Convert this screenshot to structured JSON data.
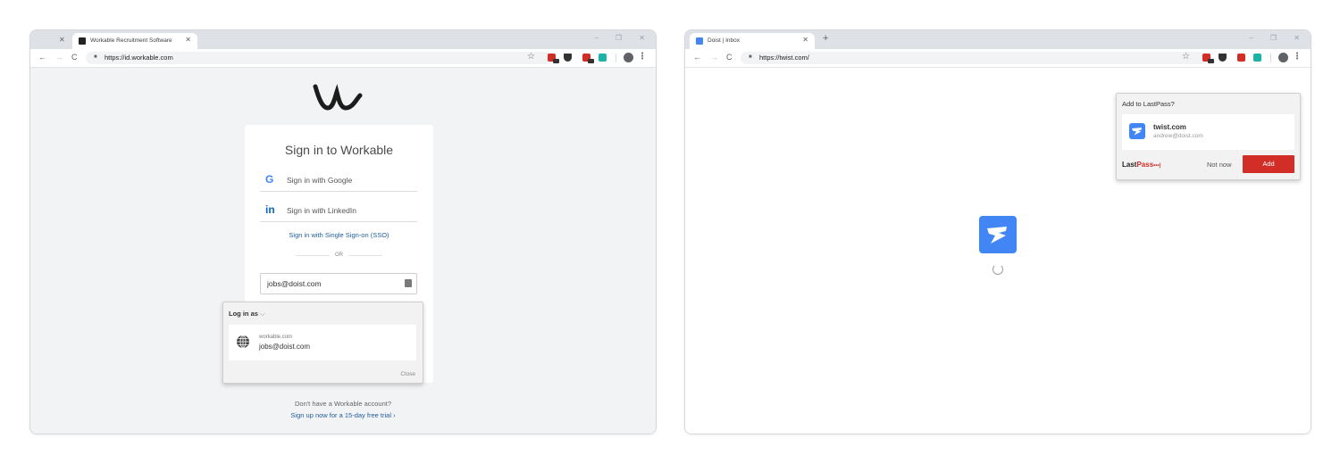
{
  "left_window": {
    "tab": {
      "title": "Workable Recruitment Software",
      "favicon_icon": "workable-favicon-icon"
    },
    "url": "https://id.workable.com",
    "window_controls": [
      "–",
      "❐",
      "✕"
    ],
    "signin": {
      "title": "Sign in to Workable",
      "google_icon": "G",
      "google_label": "Sign in with Google",
      "linkedin_icon": "in",
      "linkedin_label": "Sign in with LinkedIn",
      "sso_label": "Sign in with Single Sign-on (SSO)",
      "or_label": "OR",
      "email_value": "jobs@doist.com"
    },
    "lastpass_popup": {
      "header": "Log in as",
      "site": "workable.com",
      "account": "jobs@doist.com",
      "close_label": "Close"
    },
    "footer": {
      "question": "Don't have a Workable account?",
      "signup_link": "Sign up now for a 15-day free trial ›"
    }
  },
  "right_window": {
    "tab": {
      "title": "Doist | Inbox",
      "favicon_icon": "twist-favicon-icon"
    },
    "new_tab_label": "+",
    "url": "https://twist.com/",
    "window_controls": [
      "–",
      "❐",
      "✕"
    ],
    "lastpass_prompt": {
      "question": "Add to LastPass?",
      "site": "twist.com",
      "account": "andrew@doist.com",
      "brand_last": "Last",
      "brand_pass": "Pass",
      "brand_dots": "•••|",
      "not_now_label": "Not now",
      "add_label": "Add"
    }
  },
  "colors": {
    "workable_bg": "#f2f3f5",
    "twist_blue": "#4285f4",
    "lastpass_red": "#d32d27",
    "link_blue": "#1f5c99",
    "google_blue": "#4285f4",
    "linkedin_blue": "#0a66c2"
  }
}
